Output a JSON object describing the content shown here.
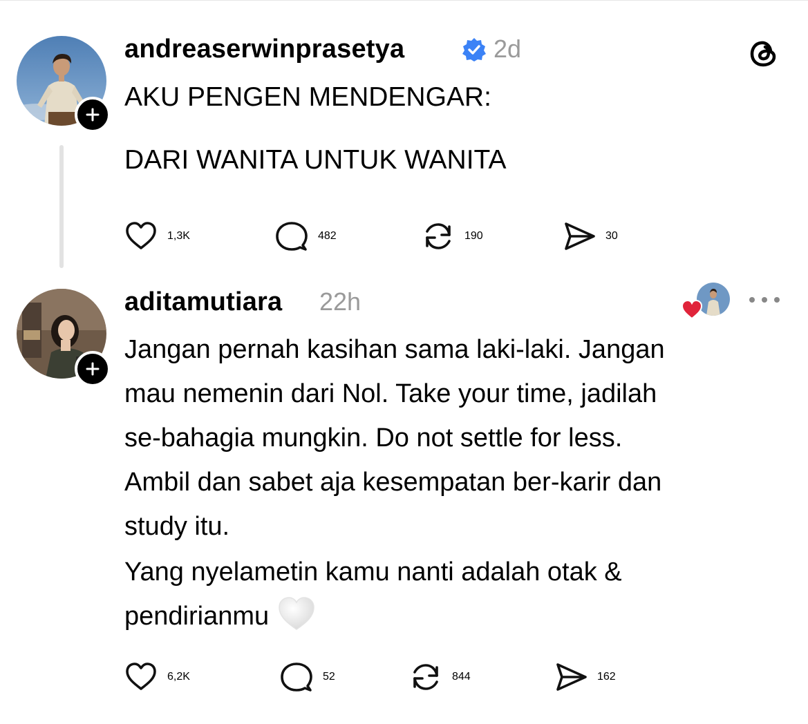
{
  "post": {
    "username": "andreaserwinprasetya",
    "time": "2d",
    "lines": [
      "AKU PENGEN MENDENGAR:",
      "DARI WANITA UNTUK WANITA"
    ],
    "likes": "1,3K",
    "comments": "482",
    "reposts": "190",
    "shares": "30"
  },
  "reply": {
    "username": "aditamutiara",
    "time": "22h",
    "para1": [
      "Jangan pernah kasihan sama laki-laki. Jangan",
      "mau nemenin dari Nol. Take your time, jadilah",
      "se-bahagia mungkin. Do not settle for less.",
      "Ambil dan sabet aja kesempatan ber-karir dan",
      "study itu."
    ],
    "para2": [
      "Yang nyelametin kamu nanti adalah otak &",
      "pendirianmu"
    ],
    "likes": "6,2K",
    "comments": "52",
    "reposts": "844",
    "shares": "162"
  },
  "icons": {
    "verified_color": "#3b82f6",
    "liked_heart_color": "#e0243a",
    "threads_logo": "threads-icon",
    "like": "heart-outline-icon",
    "comment": "comment-bubble-icon",
    "repost": "repost-icon",
    "share": "send-icon",
    "more": "more-horizontal-icon",
    "follow": "plus-icon"
  }
}
